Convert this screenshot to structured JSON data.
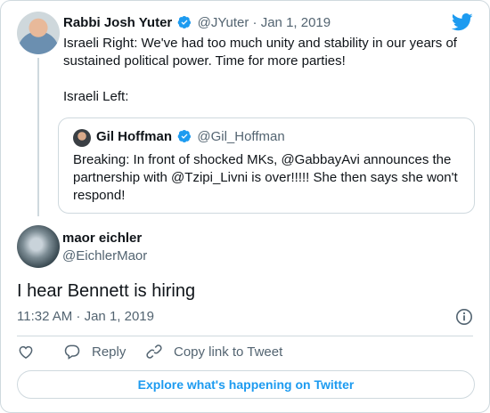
{
  "colors": {
    "accent": "#1d9bf0",
    "muted": "#536471",
    "border": "#cfd9de"
  },
  "icons": [
    "twitter-bird-icon",
    "verified-badge-icon",
    "info-icon",
    "heart-icon",
    "reply-icon",
    "link-icon"
  ],
  "parent_tweet": {
    "name": "Rabbi Josh Yuter",
    "handle": "@JYuter",
    "separator": "·",
    "date": "Jan 1, 2019",
    "text_line1": "Israeli Right: We've had too much unity and stability in our years of sustained political power. Time for more parties!",
    "text_line2": "Israeli Left:"
  },
  "quoted_tweet": {
    "name": "Gil Hoffman",
    "handle": "@Gil_Hoffman",
    "text": "Breaking: In front of shocked MKs, @GabbayAvi announces the partnership with @Tzipi_Livni is over!!!!! She then says she won't respond!"
  },
  "main_tweet": {
    "name": "maor eichler",
    "handle": "@EichlerMaor",
    "text": "I hear Bennett is hiring",
    "timestamp": "11:32 AM · Jan 1, 2019"
  },
  "actions": {
    "reply_label": "Reply",
    "copy_label": "Copy link to Tweet"
  },
  "explore_label": "Explore what's happening on Twitter"
}
